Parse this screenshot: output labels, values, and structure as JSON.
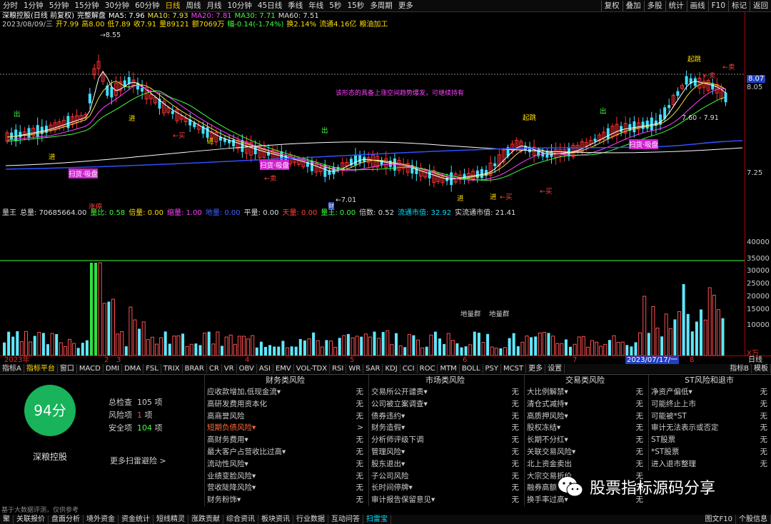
{
  "period_bar": [
    "分时",
    "1分钟",
    "5分钟",
    "15分钟",
    "30分钟",
    "60分钟",
    "日线",
    "周线",
    "月线",
    "10分钟",
    "45日线",
    "季线",
    "年线",
    "5秒",
    "15秒",
    "多周期",
    "更多"
  ],
  "period_active": "日线",
  "right_buttons": [
    "复权",
    "叠加",
    "多股",
    "统计",
    "画线",
    "F10",
    "标记",
    "返回"
  ],
  "info_line1": {
    "name": "深粮控股(日线 前复权)",
    "indicator": "完整解盘",
    "ma5": "MA5: 7.96",
    "ma10": "MA10: 7.93",
    "ma20": "MA20: 7.81",
    "ma30": "MA30: 7.71",
    "ma60": "MA60: 7.51"
  },
  "info_line2": {
    "date": "2023/08/09/三",
    "open": "开7.99",
    "high": "高8.00",
    "low": "低7.89",
    "close": "收7.91",
    "vol": "量89121",
    "amount": "额7069万",
    "change": "幅-0.14(-1.74%)",
    "turnover": "换2.14%",
    "float": "流通4.16亿",
    "industry": "粮油加工"
  },
  "annotations": {
    "max_price": "8.55",
    "min_price": "7.01",
    "mid_label": "7.60 - 7.91",
    "signal_chu": "出",
    "signal_jin": "进",
    "signal_sell": "←卖",
    "signal_buy": "←买",
    "box_label": "扫货·吸盘",
    "chart_note": "该形态的具备上涨空间趋势爆发，可继续持有",
    "zhangting": "涨停",
    "breakout": "起跳",
    "cai": "财"
  },
  "price_axis": [
    "8.07",
    "8.05",
    "7.25"
  ],
  "price_accent": "#e03030",
  "volume_header": {
    "name": "量王",
    "total": "总量: 70685664.00",
    "ratio": "量比: 0.58",
    "double": "倍量: 0.00",
    "shrink": "缩量: 1.00",
    "ground": "地量: 0.00",
    "flat": "平量: 0.00",
    "sky": "天量: 0.00",
    "king": "量王: 0.00",
    "multiple": "倍数: 0.52",
    "float_mv": "流通市值: 32.92",
    "real_mv": "实流通市值: 21.41"
  },
  "volume_axis": [
    "40000",
    "35000",
    "30000",
    "25000",
    "20000",
    "15000",
    "10000",
    "X万"
  ],
  "volume_labels": [
    "地量群",
    "地量群"
  ],
  "date_axis": {
    "year": "2023年",
    "m2": "2",
    "m3": "3",
    "m4": "4",
    "m5": "5",
    "m6": "6",
    "m7": "7",
    "cursor": "2023/07/17/一",
    "m8": "8",
    "right": "日线"
  },
  "indicator_tabs": [
    "指标A",
    "指标平台",
    "窗口",
    "MACD",
    "DMI",
    "DMA",
    "FSL",
    "TRIX",
    "BRAR",
    "CR",
    "VR",
    "OBV",
    "ASI",
    "EMV",
    "VOL-TDX",
    "RSI",
    "WR",
    "SAR",
    "KDJ",
    "CCI",
    "ROC",
    "MTM",
    "BOLL",
    "PSY",
    "MCST",
    "更多",
    "设置"
  ],
  "indicator_active": "指标平台",
  "indicator_right": [
    "指标B",
    "模板"
  ],
  "score": "94分",
  "stock_name": "深粮控股",
  "summary": {
    "total": "总检查",
    "total_val": "105 项",
    "risk": "风险项",
    "risk_val": "1",
    "risk_unit": "项",
    "safe": "安全项",
    "safe_val": "104",
    "safe_unit": "项"
  },
  "more_link": "更多扫雷避险 >",
  "footnote": "基于大数据评测，仅供参考",
  "risk_columns": [
    {
      "title": "财务类风险",
      "items": [
        {
          "name": "应收款增加,低现金流▾",
          "status": "无"
        },
        {
          "name": "高研发费用资本化",
          "status": "无"
        },
        {
          "name": "高商誉风险",
          "status": "无"
        },
        {
          "name": "短期负债风险▾",
          "status": ">",
          "warn": true
        },
        {
          "name": "高财务费用▾",
          "status": "无"
        },
        {
          "name": "最大客户占营收比过高▾",
          "status": "无"
        },
        {
          "name": "流动性风险▾",
          "status": "无"
        },
        {
          "name": "业绩变脸风险▾",
          "status": "无"
        },
        {
          "name": "营收陡降风险▾",
          "status": "无"
        },
        {
          "name": "财务粉饰▾",
          "status": "无"
        }
      ]
    },
    {
      "title": "市场类风险",
      "items": [
        {
          "name": "交易所公开谴责▾",
          "status": "无"
        },
        {
          "name": "公司被立案调查▾",
          "status": "无"
        },
        {
          "name": "债券违约▾",
          "status": "无"
        },
        {
          "name": "财务造假▾",
          "status": "无"
        },
        {
          "name": "分析师评级下调",
          "status": "无"
        },
        {
          "name": "管理风险▾",
          "status": "无"
        },
        {
          "name": "股东退出▾",
          "status": "无"
        },
        {
          "name": "子公司风险",
          "status": "无"
        },
        {
          "name": "长时间停牌▾",
          "status": "无"
        },
        {
          "name": "审计报告保留意见▾",
          "status": "无"
        }
      ]
    },
    {
      "title": "交易类风险",
      "items": [
        {
          "name": "大比例解禁▾",
          "status": "无"
        },
        {
          "name": "清仓式减持▾",
          "status": "无"
        },
        {
          "name": "高质押风险▾",
          "status": "无"
        },
        {
          "name": "股权冻结▾",
          "status": "无"
        },
        {
          "name": "长期不分红▾",
          "status": "无"
        },
        {
          "name": "关联交易风险▾",
          "status": "无"
        },
        {
          "name": "北上资金卖出",
          "status": "无"
        },
        {
          "name": "大宗交易折价",
          "status": "无"
        },
        {
          "name": "融券高额",
          "status": "无"
        },
        {
          "name": "换手率过高▾",
          "status": "无"
        }
      ]
    },
    {
      "title": "ST风险和退市",
      "items": [
        {
          "name": "净资产偏低▾",
          "status": "无"
        },
        {
          "name": "可能终止上市",
          "status": "无"
        },
        {
          "name": "可能被*ST",
          "status": "无"
        },
        {
          "name": "审计无法表示或否定",
          "status": "无"
        },
        {
          "name": "ST股票",
          "status": "无"
        },
        {
          "name": "*ST股票",
          "status": "无"
        },
        {
          "name": "进入退市整理",
          "status": "无"
        }
      ]
    }
  ],
  "bottom_tabs": [
    "聚",
    "关联报价",
    "盘面分析",
    "境外资金",
    "资金统计",
    "短线精灵",
    "涨跌贡献",
    "综合资讯",
    "板块资讯",
    "行业数据",
    "互动问答",
    "扫雷宝"
  ],
  "bottom_active": "扫雷宝",
  "bottom_right": [
    "图文F10",
    "个股信息"
  ],
  "watermark": "股票指标源码分享"
}
